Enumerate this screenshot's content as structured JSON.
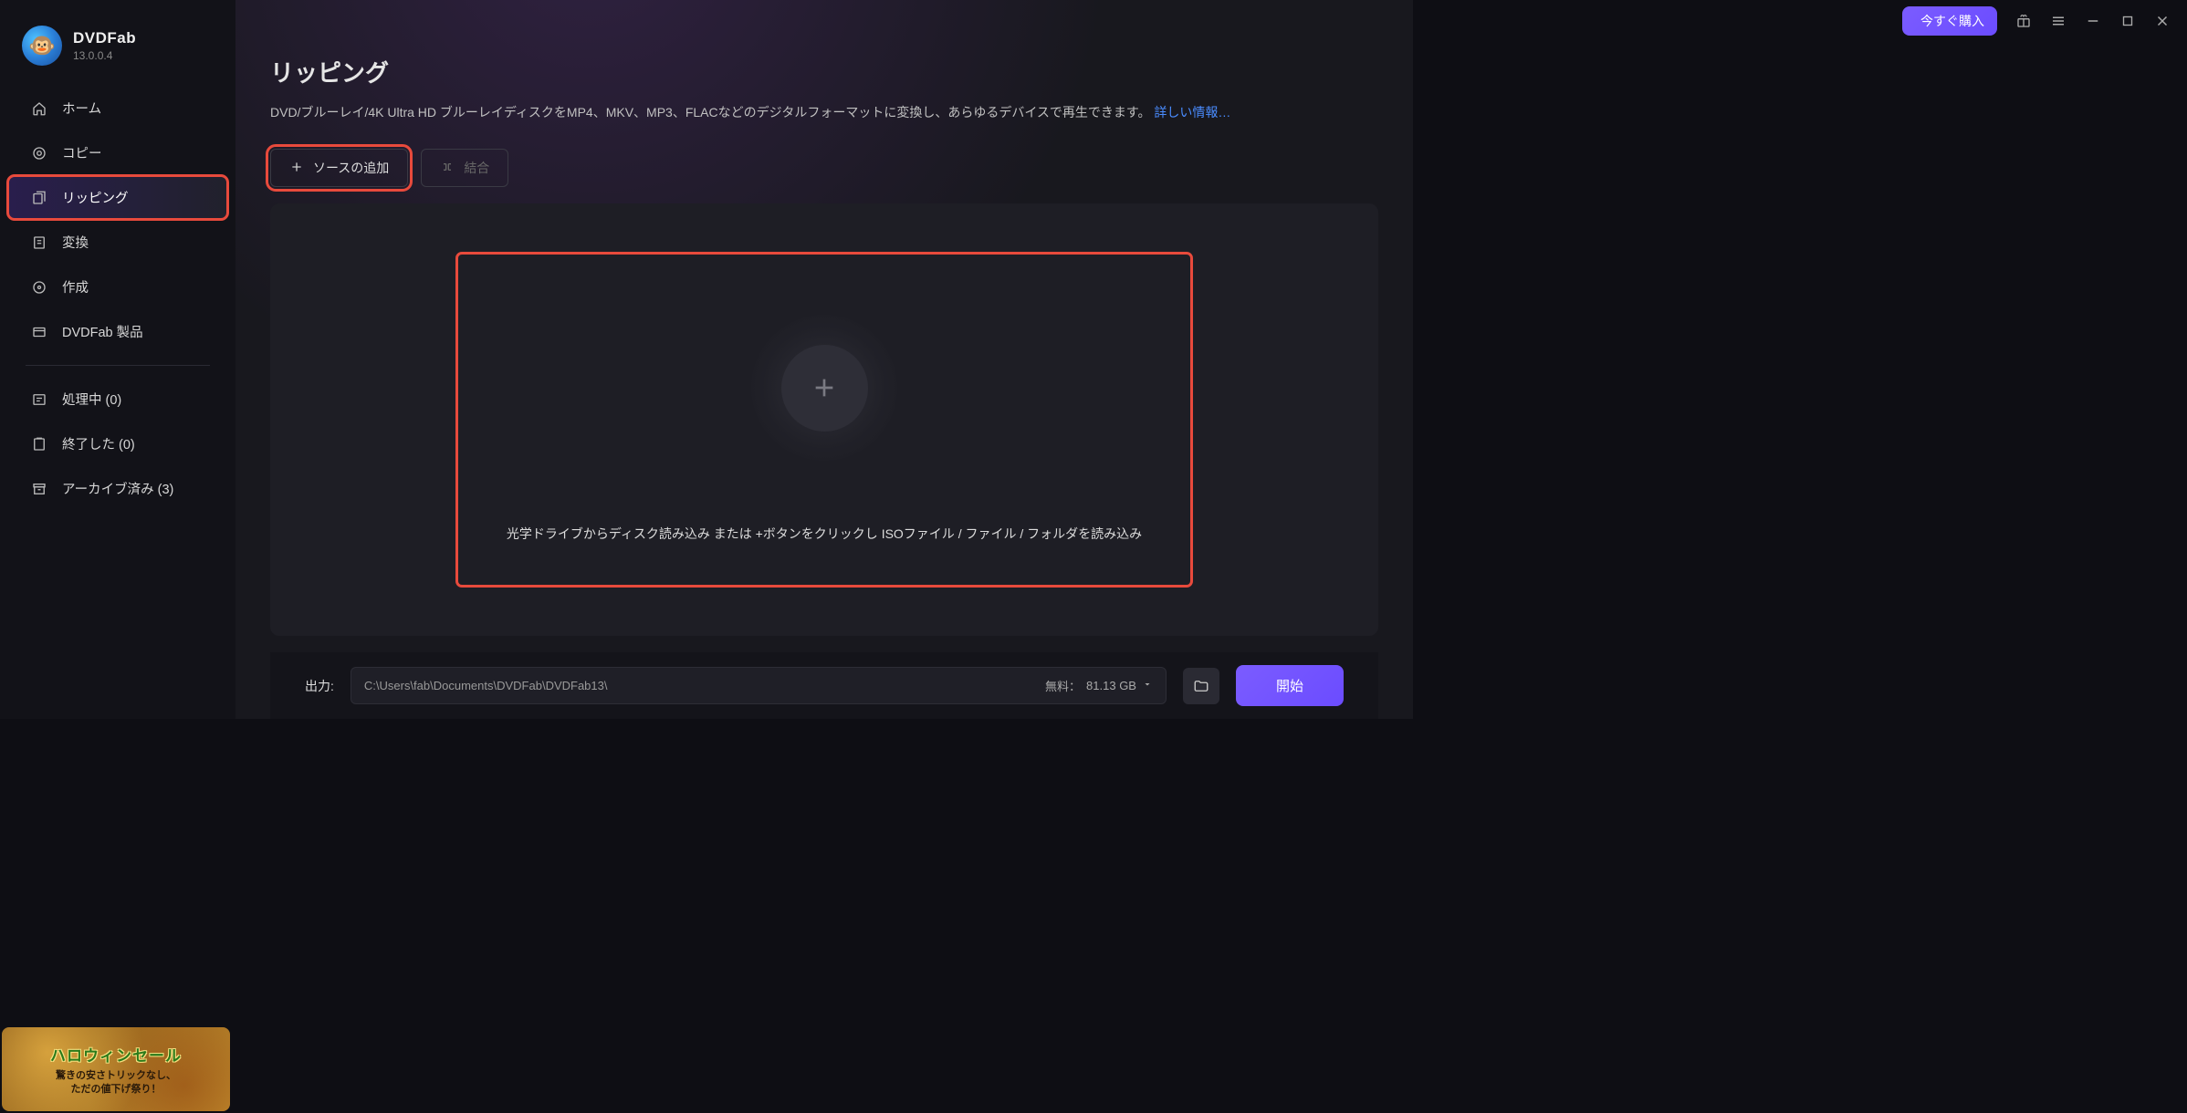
{
  "app": {
    "name": "DVDFab",
    "version": "13.0.0.4"
  },
  "title_bar": {
    "buy_now": "今すぐ購入"
  },
  "sidebar": {
    "items": [
      {
        "label": "ホーム"
      },
      {
        "label": "コピー"
      },
      {
        "label": "リッピング"
      },
      {
        "label": "変換"
      },
      {
        "label": "作成"
      },
      {
        "label": "DVDFab 製品"
      }
    ],
    "queue": [
      {
        "label": "処理中 (0)"
      },
      {
        "label": "終了した (0)"
      },
      {
        "label": "アーカイブ済み (3)"
      }
    ]
  },
  "main": {
    "title": "リッピング",
    "description": "DVD/ブルーレイ/4K Ultra HD ブルーレイディスクをMP4、MKV、MP3、FLACなどのデジタルフォーマットに変換し、あらゆるデバイスで再生できます。 ",
    "more_info": "詳しい情報…",
    "add_source": "ソースの追加",
    "merge": "結合",
    "drop_text": "光学ドライブからディスク読み込み または +ボタンをクリックし ISOファイル / ファイル / フォルダを読み込み"
  },
  "footer": {
    "output_label": "出力:",
    "output_path": "C:\\Users\\fab\\Documents\\DVDFab\\DVDFab13\\",
    "free_label": "無料：",
    "free_space": "81.13 GB",
    "start": "開始"
  },
  "promo": {
    "title": "ハロウィンセール",
    "sub1": "驚きの安さトリックなし、",
    "sub2": "ただの値下げ祭り！"
  }
}
